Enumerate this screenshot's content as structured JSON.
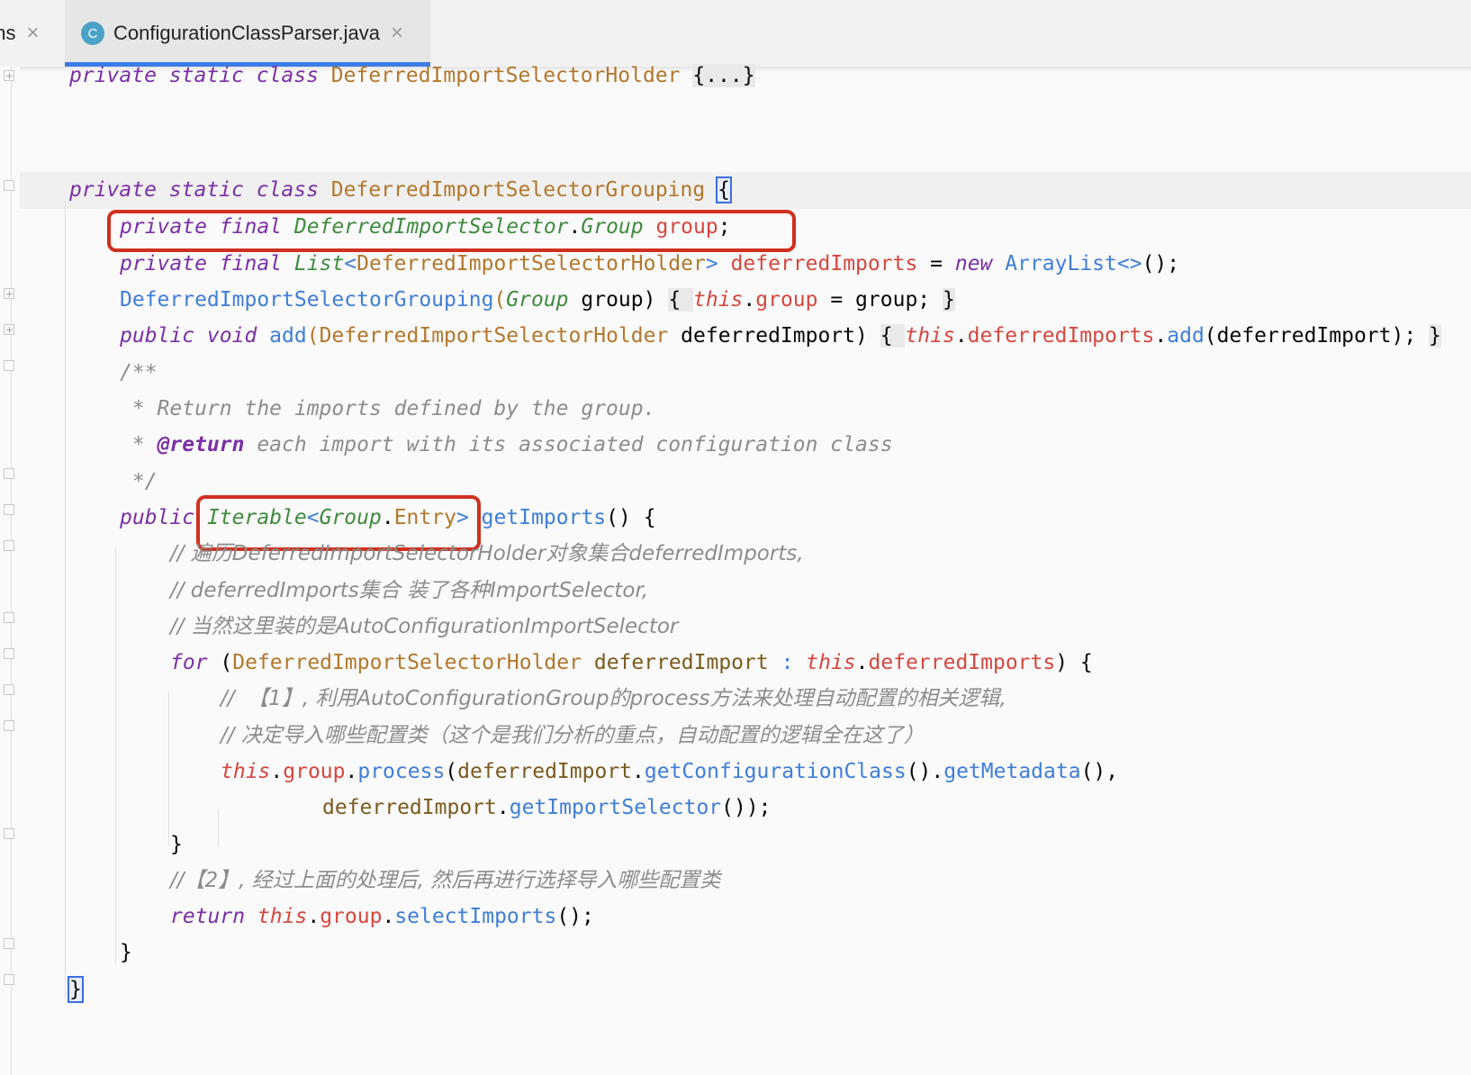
{
  "tabs": [
    {
      "label": "ans"
    },
    {
      "label": "ConfigurationClassParser.java",
      "icon": "C"
    }
  ],
  "code": {
    "l1": {
      "a": "private static class ",
      "b": "DeferredImportSelectorHolder",
      "c": " ",
      "d": "{...}"
    },
    "l4": {
      "a": "private static class ",
      "b": "DeferredImportSelectorGrouping",
      "c": " ",
      "d": "{"
    },
    "l5": {
      "a": "private final ",
      "b": "DeferredImportSelector",
      "c": ".",
      "d": "Group",
      "e": " ",
      "f": "group",
      "g": ";"
    },
    "l6": {
      "a": "private final ",
      "b": "List",
      "c": "<",
      "d": "DeferredImportSelectorHolder",
      "e": ">",
      "f": " ",
      "g": "deferredImports",
      "h": " = ",
      "i": "new",
      "j": " ",
      "k": "ArrayList<>",
      "l": "();"
    },
    "l7": {
      "a": "DeferredImportSelectorGrouping",
      "b": "(",
      "c": "Group",
      "d": " group) ",
      "e": "{ ",
      "f": "this",
      "g": ".",
      "h": "group",
      "i": " = group; ",
      "j": "}"
    },
    "l8": {
      "a": "public void ",
      "b": "add",
      "c": "(",
      "d": "DeferredImportSelectorHolder",
      "e": " deferredImport) ",
      "f": "{ ",
      "g": "this",
      "h": ".",
      "i": "deferredImports",
      "j": ".",
      "k": "add",
      "l": "(deferredImport); ",
      "m": "}"
    },
    "l9": "/**",
    "l10": " * Return the imports defined by the group.",
    "l11": {
      "a": " * ",
      "b": "@return",
      "c": " each import with its associated configuration class"
    },
    "l12": " */",
    "l13": {
      "a": "public",
      "b": " ",
      "c": "Iterable",
      "d": "<",
      "e": "Group",
      "f": ".",
      "g": "Entry",
      "h": ">",
      "i": " ",
      "j": "getImports",
      "k": "() {"
    },
    "l14": "// 遍历DeferredImportSelectorHolder对象集合deferredImports,",
    "l15": "// deferredImports集合 装了各种ImportSelector,",
    "l16": "// 当然这里装的是AutoConfigurationImportSelector",
    "l17": {
      "a": "for",
      "b": " (",
      "c": "DeferredImportSelectorHolder",
      "d": " ",
      "e": "deferredImport",
      "f": " : ",
      "g": "this",
      "h": ".",
      "i": "deferredImports",
      "j": ") {"
    },
    "l18": "//  【1】, 利用AutoConfigurationGroup的process方法来处理自动配置的相关逻辑,",
    "l19": "// 决定导入哪些配置类（这个是我们分析的重点，自动配置的逻辑全在这了）",
    "l20": {
      "a": "this",
      "b": ".",
      "c": "group",
      "d": ".",
      "e": "process",
      "f": "(",
      "g": "deferredImport",
      "h": ".",
      "i": "getConfigurationClass",
      "j": "().",
      "k": "getMetadata",
      "l": "(),"
    },
    "l21": {
      "a": "deferredImport",
      "b": ".",
      "c": "getImportSelector",
      "d": "());"
    },
    "l22": "}",
    "l23": "//【2】, 经过上面的处理后, 然后再进行选择导入哪些配置类",
    "l24": {
      "a": "return",
      "b": " ",
      "c": "this",
      "d": ".",
      "e": "group",
      "f": ".",
      "g": "selectImports",
      "h": "();"
    },
    "l25": "}",
    "l26": "}"
  }
}
